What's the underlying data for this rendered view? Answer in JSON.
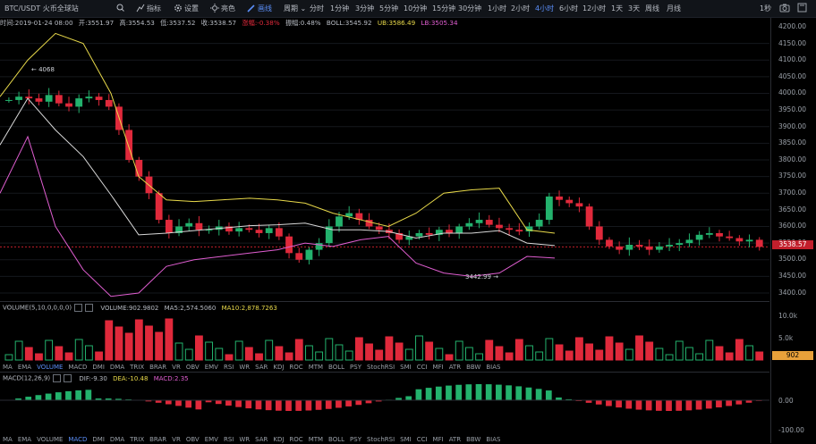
{
  "toolbar": {
    "symbol": "BTC/USDT 火币全球站",
    "items": [
      "指标",
      "设置",
      "亮色",
      "画线"
    ],
    "period_label": "周期",
    "periods": [
      "分时",
      "1分钟",
      "3分钟",
      "5分钟",
      "10分钟",
      "15分钟",
      "30分钟",
      "1小时",
      "2小时",
      "4小时",
      "6小时",
      "12小时",
      "1天",
      "3天",
      "周线",
      "月线"
    ],
    "active_period": "4小时",
    "right_label": "1秒"
  },
  "info": {
    "time_label": "时间:2019-01-24 08:00",
    "open": "开:3551.97",
    "high": "高:3554.53",
    "low": "低:3537.52",
    "close": "收:3538.57",
    "change": "涨幅:-0.38%",
    "amplitude": "振幅:0.48%",
    "boll": "BOLL:3545.92",
    "ub": "UB:3586.49",
    "lb": "LB:3505.34"
  },
  "price_axis": [
    "4200.00",
    "4150.00",
    "4100.00",
    "4050.00",
    "4000.00",
    "3950.00",
    "3900.00",
    "3850.00",
    "3800.00",
    "3750.00",
    "3700.00",
    "3650.00",
    "3600.00",
    "3550.00",
    "3500.00",
    "3450.00",
    "3400.00"
  ],
  "current_price": "3538.57",
  "annotations": {
    "high": "4068",
    "low": "3442.99"
  },
  "volume": {
    "label": "VOLUME(5,10,0,0,0,0)",
    "value": "VOLUME:902.9802",
    "ma5": "MA5:2,574.5060",
    "ma10": "MA10:2,878.7263",
    "axis": [
      "10.0k",
      "5.0k"
    ],
    "tag": "902"
  },
  "indicator_tabs": [
    "MA",
    "EMA",
    "VOLUME",
    "MACD",
    "DMI",
    "DMA",
    "TRIX",
    "BRAR",
    "VR",
    "OBV",
    "EMV",
    "RSI",
    "WR",
    "SAR",
    "KDJ",
    "ROC",
    "MTM",
    "BOLL",
    "PSY",
    "StochRSI",
    "SMI",
    "CCI",
    "MFI",
    "ATR",
    "BBW",
    "BIAS"
  ],
  "active_tab_top": "VOLUME",
  "active_tab_bottom": "MACD",
  "macd": {
    "label": "MACD(12,26,9)",
    "dif": "DIF:-9.30",
    "dea": "DEA:-10.48",
    "macd": "MACD:2.35",
    "axis": [
      "0.00",
      "-100.00"
    ]
  },
  "colors": {
    "up": "#23b26d",
    "down": "#e0293b",
    "ub": "#e8d94a",
    "lb": "#e05ed1",
    "mid": "#d8d8d8",
    "accent": "#5b8ef7"
  },
  "chart_data": {
    "type": "candlestick",
    "timeframe": "4小时",
    "ohlc_close": [
      3980,
      3990,
      3985,
      3975,
      3995,
      3970,
      3960,
      3985,
      3990,
      3980,
      3960,
      3890,
      3800,
      3750,
      3700,
      3620,
      3580,
      3600,
      3610,
      3590,
      3590,
      3600,
      3585,
      3595,
      3590,
      3580,
      3595,
      3570,
      3520,
      3500,
      3530,
      3550,
      3600,
      3630,
      3640,
      3620,
      3600,
      3590,
      3580,
      3560,
      3570,
      3580,
      3575,
      3590,
      3580,
      3600,
      3610,
      3620,
      3605,
      3595,
      3590,
      3585,
      3600,
      3620,
      3690,
      3680,
      3670,
      3660,
      3600,
      3560,
      3540,
      3530,
      3545,
      3540,
      3530,
      3540,
      3545,
      3550,
      3560,
      3575,
      3580,
      3570,
      3565,
      3555,
      3560,
      3538.57
    ],
    "bollinger": {
      "ub_approx": [
        3990,
        4100,
        4180,
        4150,
        4000,
        3750,
        3680,
        3675,
        3680,
        3685,
        3680,
        3670,
        3640,
        3620,
        3600,
        3640,
        3700,
        3710,
        3715,
        3590,
        3580
      ],
      "lb_approx": [
        3700,
        3870,
        3600,
        3470,
        3390,
        3400,
        3480,
        3500,
        3510,
        3520,
        3530,
        3550,
        3540,
        3560,
        3570,
        3490,
        3460,
        3450,
        3460,
        3510,
        3505
      ]
    }
  }
}
